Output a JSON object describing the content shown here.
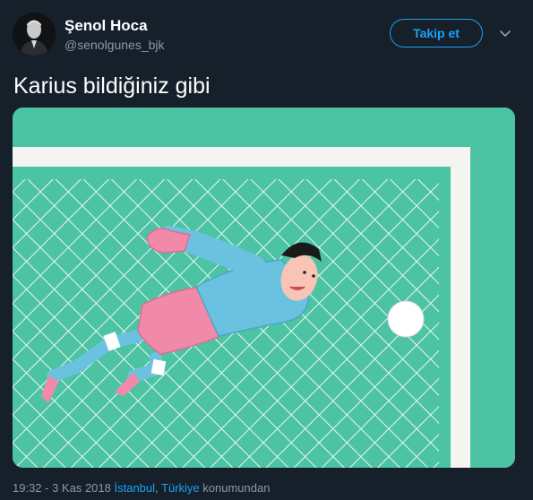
{
  "user": {
    "display_name": "Şenol Hoca",
    "handle": "@senolgunes_bjk",
    "avatar_icon": "profile-photo"
  },
  "follow_button": {
    "label": "Takip et"
  },
  "menu_icon": "chevron-down-icon",
  "tweet": {
    "text": "Karius bildiğiniz gibi"
  },
  "media": {
    "description_icon": "goalkeeper-illustration"
  },
  "meta": {
    "time_date": "19:32 - 3 Kas 2018",
    "city": "İstanbul",
    "separator": ", ",
    "country": "Türkiye",
    "suffix": "konumundan"
  },
  "colors": {
    "background": "#15202b",
    "accent": "#1da1f2",
    "secondary_text": "#8899a6",
    "pitch": "#4cc3a3"
  }
}
